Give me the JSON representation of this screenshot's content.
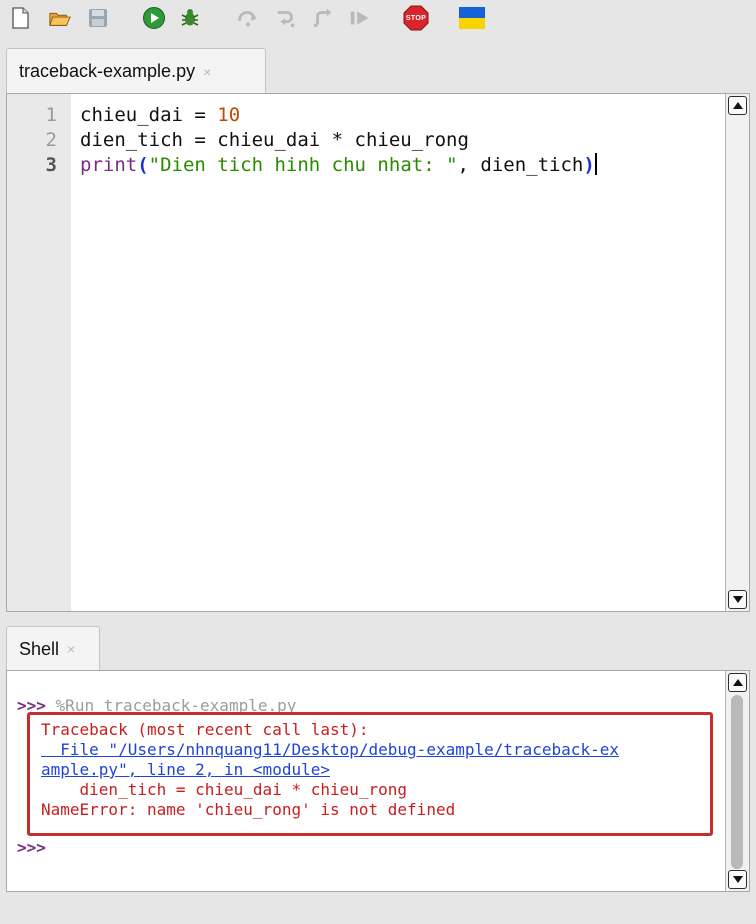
{
  "toolbar": {
    "buttons": [
      {
        "name": "new-file-icon"
      },
      {
        "name": "open-folder-icon"
      },
      {
        "name": "save-icon"
      },
      {
        "name": "run-icon"
      },
      {
        "name": "debug-icon"
      },
      {
        "name": "step-over-icon"
      },
      {
        "name": "step-into-icon"
      },
      {
        "name": "step-out-icon"
      },
      {
        "name": "resume-icon"
      },
      {
        "name": "stop-icon",
        "label": "STOP"
      },
      {
        "name": "ukraine-flag-icon"
      }
    ]
  },
  "editor": {
    "tab_label": "traceback-example.py",
    "tab_close": "×",
    "line_numbers": [
      "1",
      "2",
      "3"
    ],
    "lines": [
      {
        "a": "chieu_dai = ",
        "b": "10"
      },
      {
        "a": "dien_tich = chieu_dai * chieu_rong"
      },
      {
        "kw": "print",
        "po": "(",
        "str": "\"Dien tich hinh chu nhat: \"",
        "rest": ", dien_tich",
        "pc": ")"
      }
    ]
  },
  "shell": {
    "tab_label": "Shell",
    "tab_close": "×",
    "prompt": ">>>",
    "command": "%Run traceback-example.py",
    "traceback": {
      "header": "Traceback (most recent call last):",
      "file_line1": "  File \"/Users/nhnquang11/Desktop/debug-example/traceback-ex",
      "file_line2": "ample.py\", line 2, in <module>",
      "code_line": "    dien_tich = chieu_dai * chieu_rong",
      "error": "NameError: name 'chieu_rong' is not defined"
    },
    "end_prompt": ">>>"
  },
  "colors": {
    "error_red": "#c81e1e",
    "link_blue": "#1f44d8",
    "prompt_purple": "#7a2d87",
    "number_orange": "#c04b00",
    "string_green": "#2a8a00"
  }
}
